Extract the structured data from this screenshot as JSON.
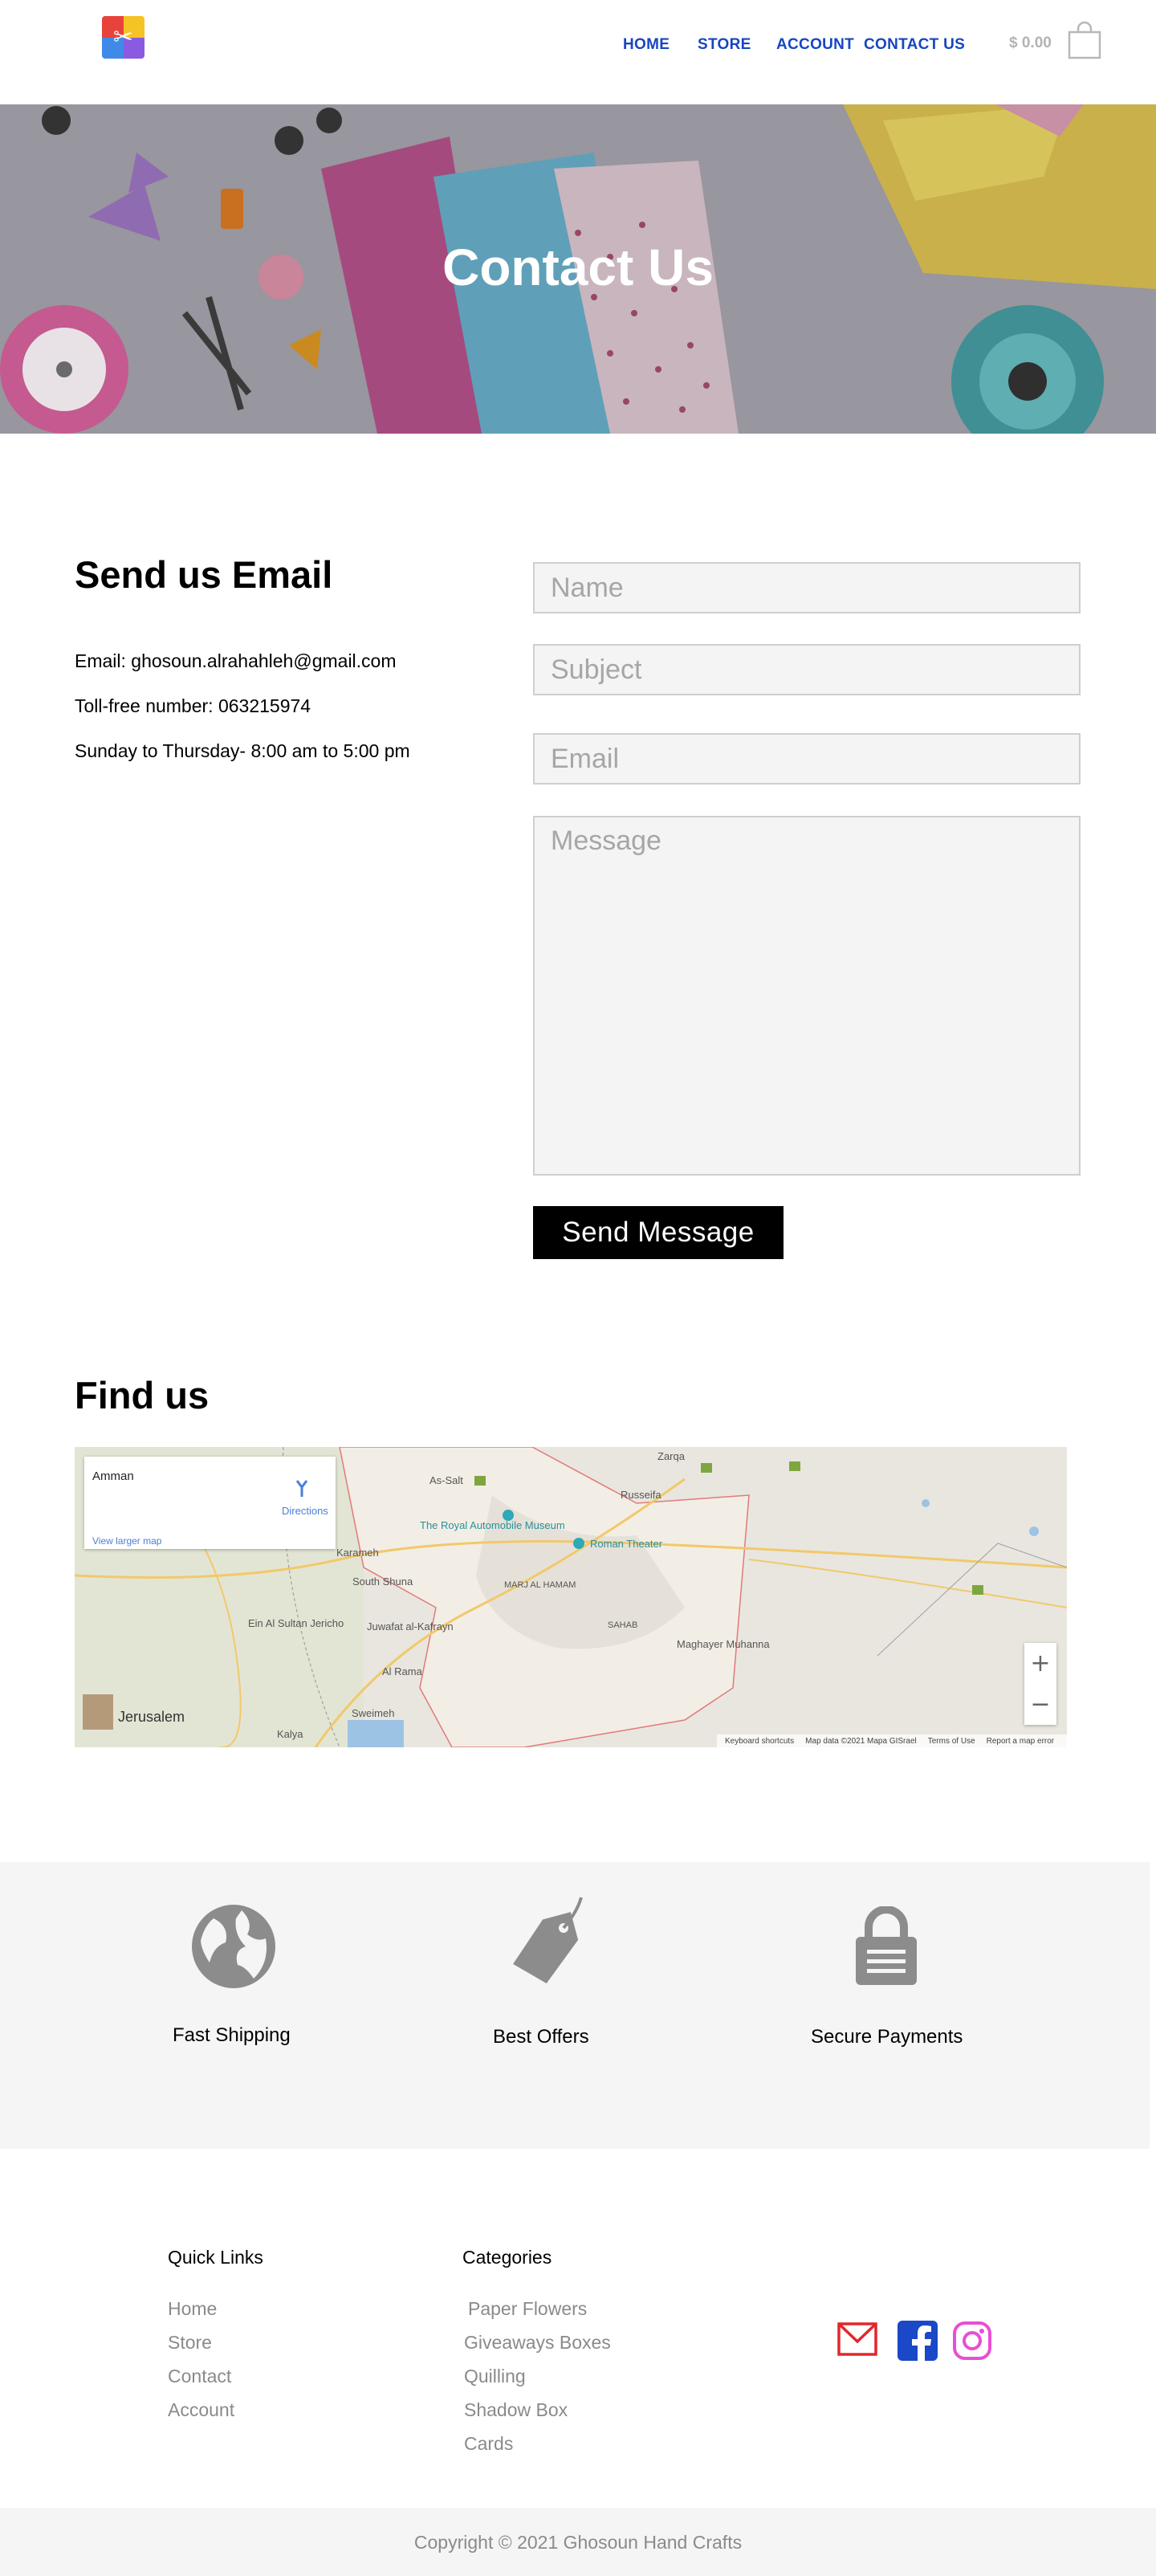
{
  "header": {
    "nav": [
      "HOME",
      "STORE",
      "ACCOUNT",
      "CONTACT US"
    ],
    "cart_total": "$ 0.00",
    "colors": {
      "nav": "#1646c0",
      "cart": "#b3b3b3"
    }
  },
  "hero": {
    "title": "Contact Us"
  },
  "contact": {
    "title": "Send us Email",
    "email_line": "Email:  ghosoun.alrahahleh@gmail.com",
    "phone_line": "Toll-free number: 063215974",
    "hours_line": "Sunday to Thursday- 8:00 am to 5:00 pm",
    "form": {
      "name_placeholder": "Name",
      "subject_placeholder": "Subject",
      "email_placeholder": "Email",
      "message_placeholder": "Message",
      "send_label": "Send  Message"
    }
  },
  "find_us": {
    "title": "Find us",
    "map": {
      "place": "Amman",
      "directions": "Directions",
      "view_larger": "View larger map",
      "labels": [
        "As-Salt",
        "Zarqa",
        "Russeifa",
        "The Royal Automobile Museum",
        "Roman Theater",
        "Karameh",
        "South Shuna",
        "Juwafat al-Kafrayn",
        "Al Rama",
        "Ein Al Sultan Jericho",
        "MARJ AL HAMAM",
        "SAHAB",
        "Maghayer Muhanna",
        "Sweimeh",
        "Kalya",
        "Jerusalem"
      ],
      "footer": [
        "Keyboard shortcuts",
        "Map data ©2021 Mapa GISrael",
        "Terms of Use",
        "Report a map error"
      ],
      "zoom_in": "+",
      "zoom_out": "−"
    }
  },
  "features": [
    {
      "label": "Fast Shipping",
      "icon": "globe-icon"
    },
    {
      "label": "Best  Offers",
      "icon": "price-tag-icon"
    },
    {
      "label": "Secure Payments",
      "icon": "lock-icon"
    }
  ],
  "footer": {
    "quick_links_title": "Quick Links",
    "quick_links": [
      "Home",
      "Store",
      "Contact",
      "Account"
    ],
    "categories_title": "Categories",
    "categories": [
      "Paper Flowers",
      "Giveaways Boxes",
      "Quilling",
      "Shadow Box",
      "Cards"
    ],
    "social": [
      "mail-icon",
      "facebook-icon",
      "instagram-icon"
    ],
    "copyright": "Copyright © 2021 Ghosoun Hand Crafts"
  }
}
